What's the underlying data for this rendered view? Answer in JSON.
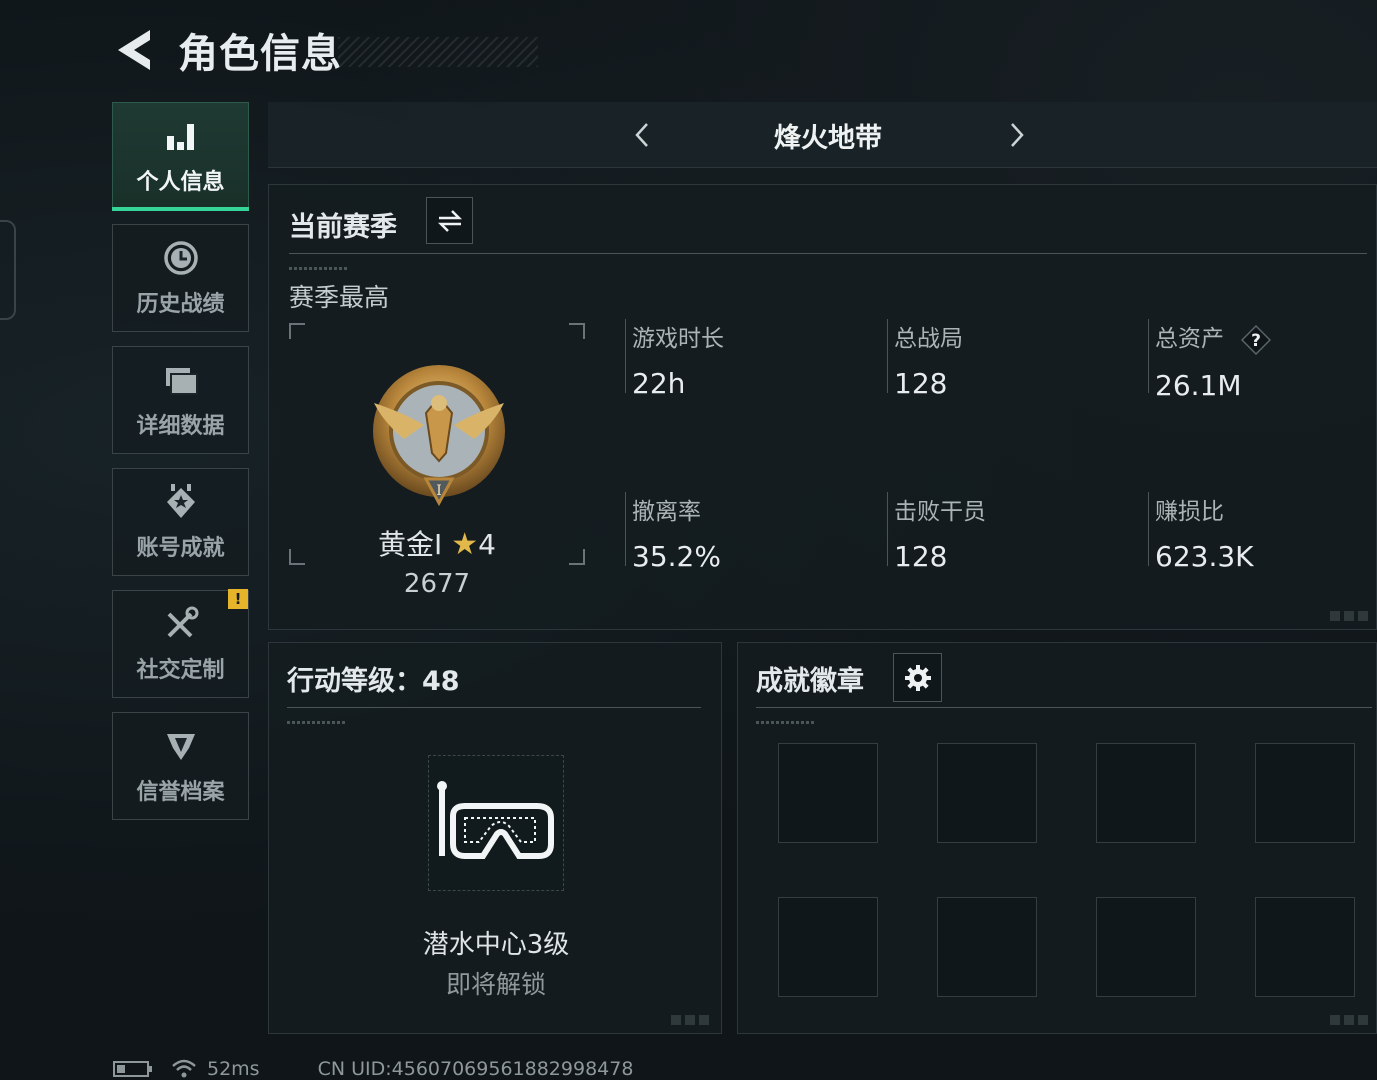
{
  "header": {
    "title": "角色信息"
  },
  "sidebar": {
    "items": [
      {
        "label": "个人信息",
        "icon": "bar-chart-icon",
        "active": true
      },
      {
        "label": "历史战绩",
        "icon": "history-clock-icon",
        "active": false
      },
      {
        "label": "详细数据",
        "icon": "folder-icon",
        "active": false
      },
      {
        "label": "账号成就",
        "icon": "achievement-icon",
        "active": false
      },
      {
        "label": "社交定制",
        "icon": "tools-icon",
        "active": false,
        "alert": "!"
      },
      {
        "label": "信誉档案",
        "icon": "shield-icon",
        "active": false
      }
    ]
  },
  "mode": {
    "title": "烽火地带"
  },
  "season": {
    "title": "当前赛季",
    "subtitle": "赛季最高",
    "rank": {
      "tier": "黄金Ⅰ",
      "star": "★",
      "stars": "4",
      "score": "2677"
    },
    "stats": [
      {
        "label": "游戏时长",
        "value": "22h"
      },
      {
        "label": "总战局",
        "value": "128"
      },
      {
        "label": "总资产",
        "value": "26.1M",
        "help": "?"
      },
      {
        "label": "撤离率",
        "value": "35.2%"
      },
      {
        "label": "击败干员",
        "value": "128"
      },
      {
        "label": "赚损比",
        "value": "623.3K"
      }
    ]
  },
  "level": {
    "title": "行动等级：48",
    "item_name": "潜水中心3级",
    "item_status": "即将解锁"
  },
  "badges": {
    "title": "成就徽章",
    "slot_count": 8
  },
  "status": {
    "ping": "52ms",
    "uid": "CN UID:4560706956188299847​8"
  },
  "colors": {
    "accent": "#35d59a",
    "alert": "#e5b42b",
    "gold": "#e2b84a"
  }
}
